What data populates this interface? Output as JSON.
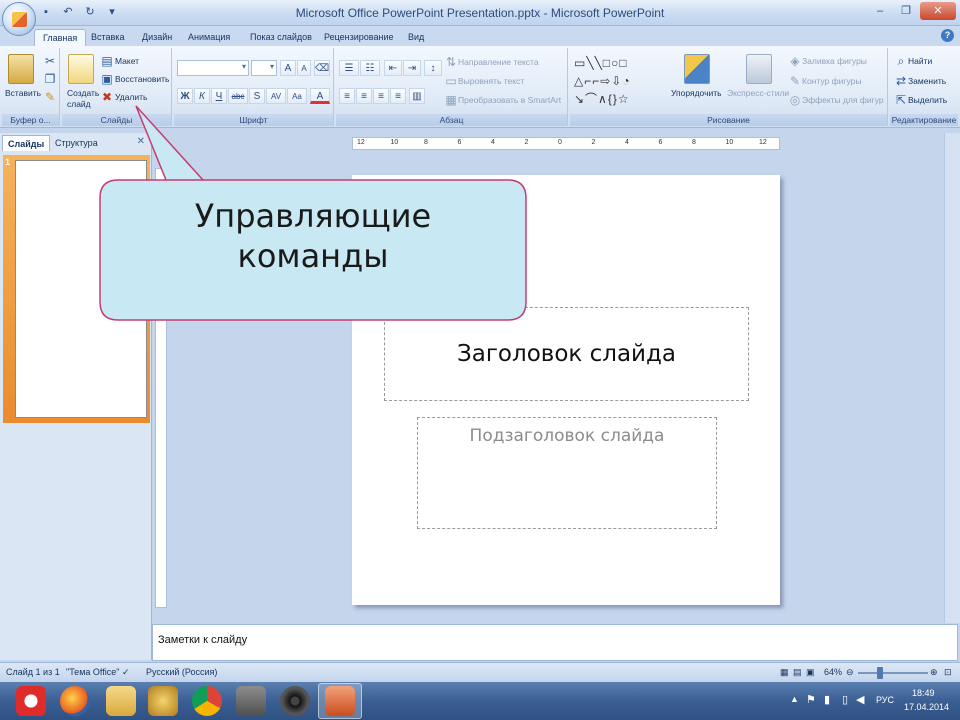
{
  "window": {
    "title": "Microsoft Office PowerPoint Presentation.pptx - Microsoft PowerPoint",
    "controls": [
      "–",
      "❐",
      "✕"
    ]
  },
  "qat_icons": [
    "save-icon",
    "undo-icon",
    "redo-icon",
    "customize-icon"
  ],
  "tabs": [
    "Главная",
    "Вставка",
    "Дизайн",
    "Анимация",
    "Показ слайдов",
    "Рецензирование",
    "Вид"
  ],
  "ribbon": {
    "clipboard": {
      "paste": "Вставить",
      "label": "Буфер о..."
    },
    "slides": {
      "new_slide_line1": "Создать",
      "new_slide_line2": "слайд",
      "layout": "Макет",
      "reset": "Восстановить",
      "delete": "Удалить",
      "label": "Слайды"
    },
    "font": {
      "bold": "Ж",
      "italic": "К",
      "underline": "Ч",
      "strike": "abc",
      "shadow": "S",
      "spacing": "AV",
      "case": "Aa",
      "grow": "A",
      "shrink": "A",
      "clear": "⌫",
      "color": "A",
      "label": "Шрифт"
    },
    "paragraph": {
      "text_direction": "Направление текста",
      "align_text": "Выровнять текст",
      "smartart": "Преобразовать в SmartArt",
      "label": "Абзац"
    },
    "drawing": {
      "arrange": "Упорядочить",
      "quick_styles": "Экспресс-стили",
      "shape_fill": "Заливка фигуры",
      "shape_outline": "Контур фигуры",
      "shape_effects": "Эффекты для фигур",
      "label": "Рисование"
    },
    "editing": {
      "find": "Найти",
      "replace": "Заменить",
      "select": "Выделить",
      "label": "Редактирование"
    }
  },
  "left_pane": {
    "tab_slides": "Слайды",
    "tab_outline": "Структура",
    "slide_number": "1"
  },
  "ruler_marks": [
    "12",
    "10",
    "8",
    "6",
    "4",
    "2",
    "0",
    "2",
    "4",
    "6",
    "8",
    "10",
    "12"
  ],
  "slide": {
    "title_placeholder": "Заголовок слайда",
    "subtitle_placeholder": "Подзаголовок слайда"
  },
  "callout": {
    "line1": "Управляющие",
    "line2": "команды"
  },
  "notes_placeholder": "Заметки к слайду",
  "status": {
    "slide_info": "Слайд 1 из 1",
    "theme": "\"Тема Office\"",
    "language": "Русский (Россия)",
    "zoom": "64%",
    "zoom_level": 0.64
  },
  "taskbar": {
    "apps": [
      "yandex-browser-icon",
      "firefox-icon",
      "file-explorer-icon",
      "app-icon",
      "chrome-icon",
      "game-icon",
      "media-player-icon",
      "powerpoint-icon"
    ],
    "lang": "РУС",
    "time": "18:49",
    "date": "17.04.2014"
  },
  "colors": {
    "ribbon_bg": "#dfe9f6",
    "callout_fill": "#c8e8f3",
    "callout_border": "#c53c72",
    "slide_thumb_selected": "#f0a146"
  }
}
